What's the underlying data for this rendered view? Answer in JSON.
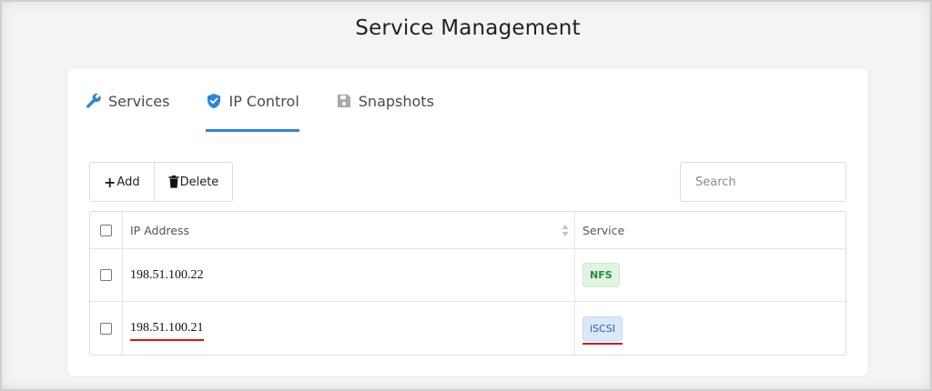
{
  "page": {
    "title": "Service Management"
  },
  "tabs": [
    {
      "label": "Services",
      "icon": "wrench-icon",
      "active": false
    },
    {
      "label": "IP Control",
      "icon": "shield-check-icon",
      "active": true
    },
    {
      "label": "Snapshots",
      "icon": "floppy-disk-icon",
      "active": false
    }
  ],
  "toolbar": {
    "add_label": "Add",
    "delete_label": "Delete"
  },
  "search": {
    "placeholder": "Search",
    "value": ""
  },
  "table": {
    "columns": [
      "IP Address",
      "Service"
    ],
    "rows": [
      {
        "ip": "198.51.100.22",
        "service": "NFS"
      },
      {
        "ip": "198.51.100.21",
        "service": "iSCSI"
      }
    ]
  },
  "colors": {
    "accent": "#2d87d9",
    "nfs_badge": "#dff5e2",
    "iscsi_badge": "#d9e8fb",
    "highlight_underline": "#e01010"
  }
}
